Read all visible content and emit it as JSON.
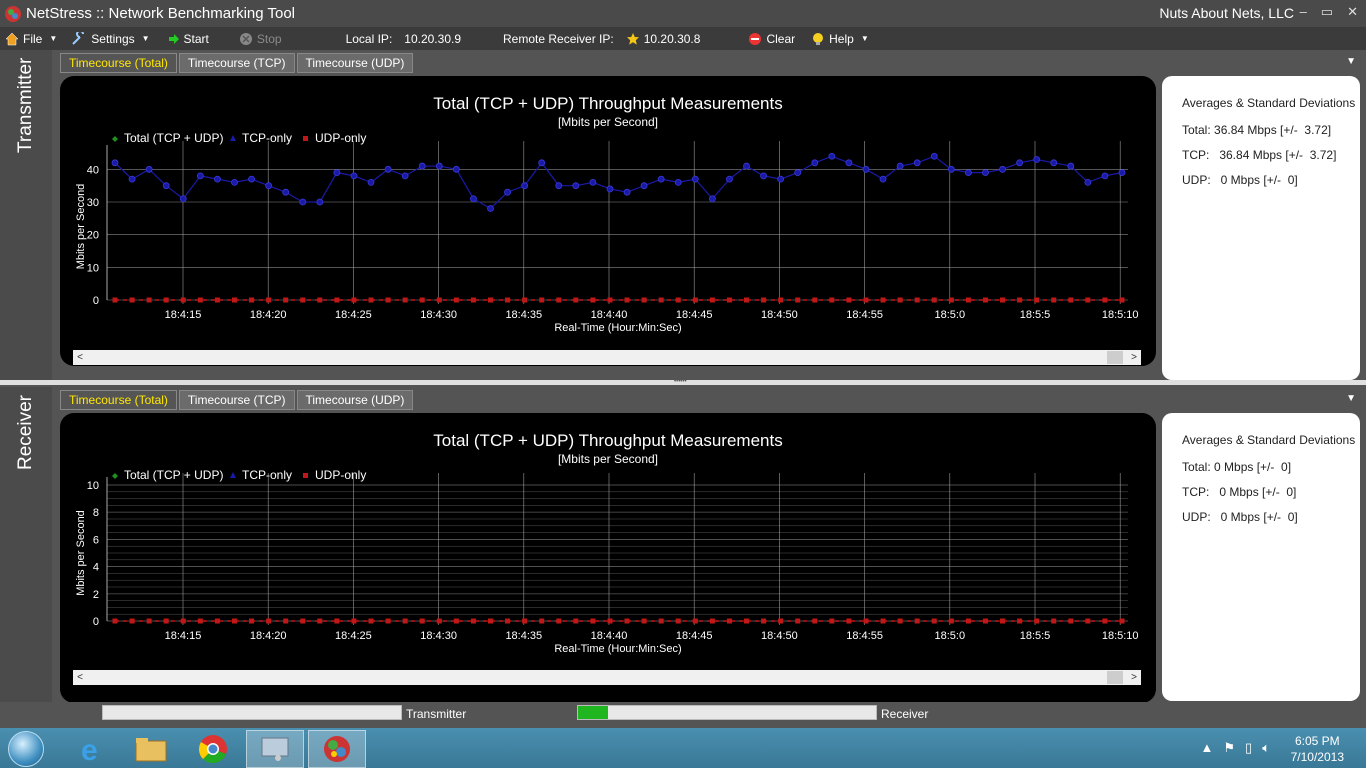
{
  "app": {
    "title": "NetStress :: Network Benchmarking Tool",
    "company": "Nuts About Nets, LLC",
    "window_buttons": [
      "–",
      "▭",
      "✕"
    ]
  },
  "toolbar": {
    "file": "File",
    "settings": "Settings",
    "start": "Start",
    "stop": "Stop",
    "local_ip_label": "Local IP:",
    "local_ip": "10.20.30.9",
    "remote_ip_label": "Remote Receiver IP:",
    "remote_ip": "10.20.30.8",
    "clear": "Clear",
    "help": "Help"
  },
  "tabs": [
    "Timecourse (Total)",
    "Timecourse (TCP)",
    "Timecourse (UDP)"
  ],
  "transmitter": {
    "side_label": "Transmitter",
    "stats": {
      "title": "Averages & Standard Deviations",
      "total": "Total: 36.84 Mbps [+/-  3.72]",
      "tcp": "TCP:   36.84 Mbps [+/-  3.72]",
      "udp": "UDP:   0 Mbps [+/-  0]"
    }
  },
  "receiver": {
    "side_label": "Receiver",
    "stats": {
      "title": "Averages & Standard Deviations",
      "total": "Total: 0 Mbps [+/-  0]",
      "tcp": "TCP:   0 Mbps [+/-  0]",
      "udp": "UDP:   0 Mbps [+/-  0]"
    }
  },
  "chart_data": [
    {
      "type": "line",
      "title": "Total (TCP + UDP) Throughput Measurements",
      "subtitle": "[Mbits per Second]",
      "xlabel": "Real-Time (Hour:Min:Sec)",
      "ylabel": "Mbits per Second",
      "ylim": [
        0,
        45
      ],
      "yticks": [
        0,
        10,
        20,
        30,
        40
      ],
      "x_tick_labels": [
        "18:4:15",
        "18:4:20",
        "18:4:25",
        "18:4:30",
        "18:4:35",
        "18:4:40",
        "18:4:45",
        "18:4:50",
        "18:4:55",
        "18:5:0",
        "18:5:5",
        "18:5:10"
      ],
      "legend": [
        "Total (TCP + UDP)",
        "TCP-only",
        "UDP-only"
      ],
      "series_colors": [
        "#1f8f1f",
        "#1a1aa8",
        "#c01818"
      ],
      "tcp_values": [
        42,
        37,
        40,
        35,
        31,
        38,
        37,
        36,
        37,
        35,
        33,
        30,
        30,
        39,
        38,
        36,
        40,
        38,
        41,
        41,
        40,
        31,
        28,
        33,
        35,
        42,
        35,
        35,
        36,
        34,
        33,
        35,
        37,
        36,
        37,
        31,
        37,
        41,
        38,
        37,
        39,
        42,
        44,
        42,
        40,
        37,
        41,
        42,
        44,
        40,
        39,
        39,
        40,
        42,
        43,
        42,
        41,
        36,
        38,
        39
      ],
      "udp_value": 0
    },
    {
      "type": "line",
      "title": "Total (TCP + UDP) Throughput Measurements",
      "subtitle": "[Mbits per Second]",
      "xlabel": "Real-Time (Hour:Min:Sec)",
      "ylabel": "Mbits per Second",
      "ylim": [
        0,
        10
      ],
      "yticks": [
        0,
        2,
        4,
        6,
        8,
        10
      ],
      "x_tick_labels": [
        "18:4:15",
        "18:4:20",
        "18:4:25",
        "18:4:30",
        "18:4:35",
        "18:4:40",
        "18:4:45",
        "18:4:50",
        "18:4:55",
        "18:5:0",
        "18:5:5",
        "18:5:10"
      ],
      "legend": [
        "Total (TCP + UDP)",
        "TCP-only",
        "UDP-only"
      ],
      "series_colors": [
        "#1f8f1f",
        "#1a1aa8",
        "#c01818"
      ],
      "udp_value": 0
    }
  ],
  "progress": {
    "transmitter_label": "Transmitter",
    "transmitter_fraction": 0,
    "receiver_label": "Receiver",
    "receiver_fraction": 0.1
  },
  "taskbar": {
    "time": "6:05 PM",
    "date": "7/10/2013"
  }
}
